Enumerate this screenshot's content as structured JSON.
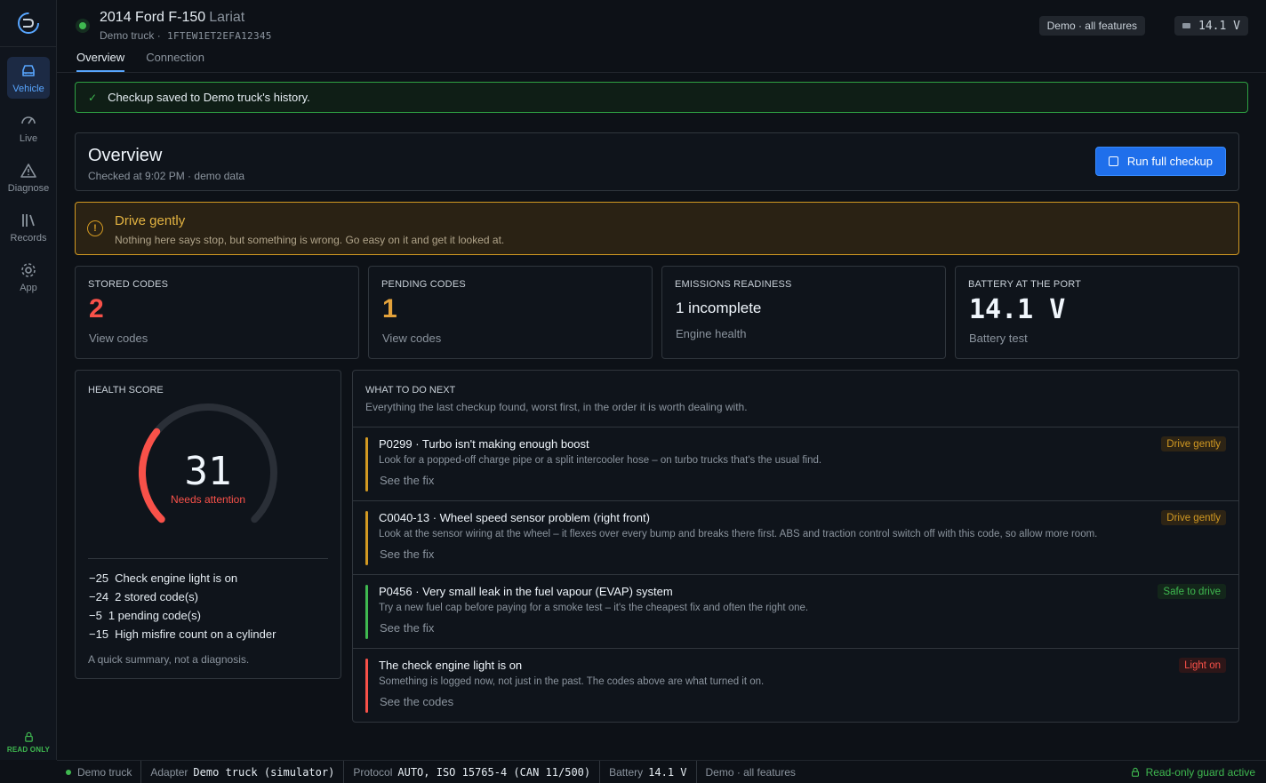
{
  "sidebar": {
    "items": [
      {
        "label": "Vehicle",
        "icon": "car-icon"
      },
      {
        "label": "Live",
        "icon": "gauge-icon"
      },
      {
        "label": "Diagnose",
        "icon": "warning-icon"
      },
      {
        "label": "Records",
        "icon": "books-icon"
      },
      {
        "label": "App",
        "icon": "gear-icon"
      }
    ],
    "readonly_label": "READ ONLY"
  },
  "header": {
    "vehicle_name": "2014 Ford F-150",
    "trim": "Lariat",
    "profile": "Demo truck",
    "separator": "·",
    "vin": "1FTEW1ET2EFA12345",
    "mode_badge": "Demo · all features",
    "voltage_badge": "14.1 V",
    "tabs": [
      {
        "label": "Overview",
        "active": true
      },
      {
        "label": "Connection",
        "active": false
      }
    ]
  },
  "toast": {
    "message": "Checkup saved to Demo truck's history."
  },
  "overview": {
    "title": "Overview",
    "subtitle": "Checked at 9:02 PM · demo data",
    "run_button": "Run full checkup"
  },
  "alert": {
    "title": "Drive gently",
    "text": "Nothing here says stop, but something is wrong. Go easy on it and get it looked at."
  },
  "stats": [
    {
      "label": "STORED CODES",
      "value": "2",
      "link": "View codes",
      "color": "#f85149"
    },
    {
      "label": "PENDING CODES",
      "value": "1",
      "link": "View codes",
      "color": "#e3a23b"
    },
    {
      "label": "EMISSIONS READINESS",
      "value": "1 incomplete",
      "link": "Engine health",
      "color": "#f0f6fc"
    },
    {
      "label": "BATTERY AT THE PORT",
      "value": "14.1 V",
      "link": "Battery test",
      "color": "#f0f6fc"
    }
  ],
  "health": {
    "label": "HEALTH SCORE",
    "score": "31",
    "score_fraction": 0.31,
    "status": "Needs attention",
    "penalties": [
      {
        "points": "−25",
        "text": "Check engine light is on"
      },
      {
        "points": "−24",
        "text": "2 stored code(s)"
      },
      {
        "points": "−5",
        "text": "1 pending code(s)"
      },
      {
        "points": "−15",
        "text": "High misfire count on a cylinder"
      }
    ],
    "footnote": "A quick summary, not a diagnosis."
  },
  "next_steps": {
    "heading": "WHAT TO DO NEXT",
    "subheading": "Everything the last checkup found, worst first, in the order it is worth dealing with.",
    "items": [
      {
        "title": "P0299 · Turbo isn't making enough boost",
        "detail": "Look for a popped-off charge pipe or a split intercooler hose – on turbo trucks that's the usual find.",
        "link": "See the fix",
        "badge": "Drive gently",
        "color": "#d29922"
      },
      {
        "title": "C0040-13 · Wheel speed sensor problem (right front)",
        "detail": "Look at the sensor wiring at the wheel – it flexes over every bump and breaks there first. ABS and traction control switch off with this code, so allow more room.",
        "link": "See the fix",
        "badge": "Drive gently",
        "color": "#d29922"
      },
      {
        "title": "P0456 · Very small leak in the fuel vapour (EVAP) system",
        "detail": "Try a new fuel cap before paying for a smoke test – it's the cheapest fix and often the right one.",
        "link": "See the fix",
        "badge": "Safe to drive",
        "color": "#3fb950"
      },
      {
        "title": "The check engine light is on",
        "detail": "Something is logged now, not just in the past. The codes above are what turned it on.",
        "link": "See the codes",
        "badge": "Light on",
        "color": "#f85149"
      }
    ]
  },
  "statusbar": {
    "profile": "Demo truck",
    "adapter_label": "Adapter",
    "adapter_value": "Demo truck (simulator)",
    "protocol_label": "Protocol",
    "protocol_value": "AUTO, ISO 15765-4 (CAN 11/500)",
    "battery_label": "Battery",
    "battery_value": "14.1 V",
    "mode": "Demo · all features",
    "guard": "Read-only guard active"
  }
}
